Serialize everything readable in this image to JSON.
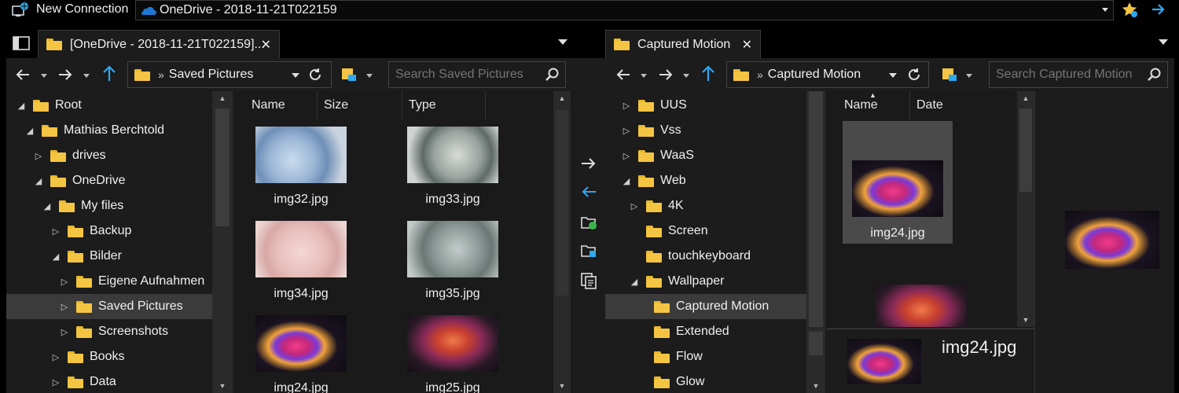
{
  "topbar": {
    "connection_label": "New Connection",
    "address_label": "OneDrive - 2018-11-21T022159"
  },
  "left": {
    "tab_label": "[OneDrive - 2018-11-21T022159]...",
    "path_label": "Saved Pictures",
    "search_placeholder": "Search Saved Pictures",
    "columns": [
      "Name",
      "Size",
      "Type"
    ],
    "tree": [
      {
        "label": "Root",
        "expander": "expanded",
        "indent": 0
      },
      {
        "label": "Mathias Berchtold",
        "expander": "expanded",
        "indent": 1
      },
      {
        "label": "drives",
        "expander": "collapsed",
        "indent": 2
      },
      {
        "label": "OneDrive",
        "expander": "expanded",
        "indent": 2
      },
      {
        "label": "My files",
        "expander": "expanded",
        "indent": 3
      },
      {
        "label": "Backup",
        "expander": "collapsed",
        "indent": 4
      },
      {
        "label": "Bilder",
        "expander": "expanded",
        "indent": 4
      },
      {
        "label": "Eigene Aufnahmen",
        "expander": "collapsed",
        "indent": 5
      },
      {
        "label": "Saved Pictures",
        "expander": "collapsed",
        "indent": 5,
        "selected": true
      },
      {
        "label": "Screenshots",
        "expander": "collapsed",
        "indent": 5
      },
      {
        "label": "Books",
        "expander": "collapsed",
        "indent": 4
      },
      {
        "label": "Data",
        "expander": "collapsed",
        "indent": 4
      }
    ],
    "files": [
      {
        "name": "img32.jpg",
        "img": "img-blue"
      },
      {
        "name": "img33.jpg",
        "img": "img-grey"
      },
      {
        "name": "img34.jpg",
        "img": "img-pink"
      },
      {
        "name": "img35.jpg",
        "img": "img-sage"
      },
      {
        "name": "img24.jpg",
        "img": "img-flower"
      },
      {
        "name": "img25.jpg",
        "img": "img-ribbon"
      }
    ]
  },
  "right": {
    "tab_label": "Captured Motion",
    "path_label": "Captured Motion",
    "search_placeholder": "Search Captured Motion",
    "columns": [
      "Name",
      "Date"
    ],
    "tree": [
      {
        "label": "UUS",
        "expander": "collapsed",
        "indent": 0
      },
      {
        "label": "Vss",
        "expander": "collapsed",
        "indent": 0
      },
      {
        "label": "WaaS",
        "expander": "collapsed",
        "indent": 0
      },
      {
        "label": "Web",
        "expander": "expanded",
        "indent": 0
      },
      {
        "label": "4K",
        "expander": "collapsed",
        "indent": 1
      },
      {
        "label": "Screen",
        "expander": "none",
        "indent": 1
      },
      {
        "label": "touchkeyboard",
        "expander": "none",
        "indent": 1
      },
      {
        "label": "Wallpaper",
        "expander": "expanded",
        "indent": 1
      },
      {
        "label": "Captured Motion",
        "expander": "none",
        "indent": 2,
        "selected": true
      },
      {
        "label": "Extended",
        "expander": "none",
        "indent": 2
      },
      {
        "label": "Flow",
        "expander": "none",
        "indent": 2
      },
      {
        "label": "Glow",
        "expander": "none",
        "indent": 2
      }
    ],
    "files": [
      {
        "name": "img24.jpg",
        "img": "img-flower",
        "selected": true
      },
      {
        "name": "",
        "img": "img-ribbon"
      }
    ],
    "preview_name": "img24.jpg"
  },
  "colors": {
    "accent": "#2ea8f0",
    "folder": "#f4c542"
  },
  "icons": [
    "connection-icon",
    "onedrive-icon",
    "favorites-icon",
    "go-icon",
    "copy-right-icon",
    "copy-left-icon",
    "sync-folder-icon",
    "compare-folder-icon",
    "clipboard-icon"
  ]
}
